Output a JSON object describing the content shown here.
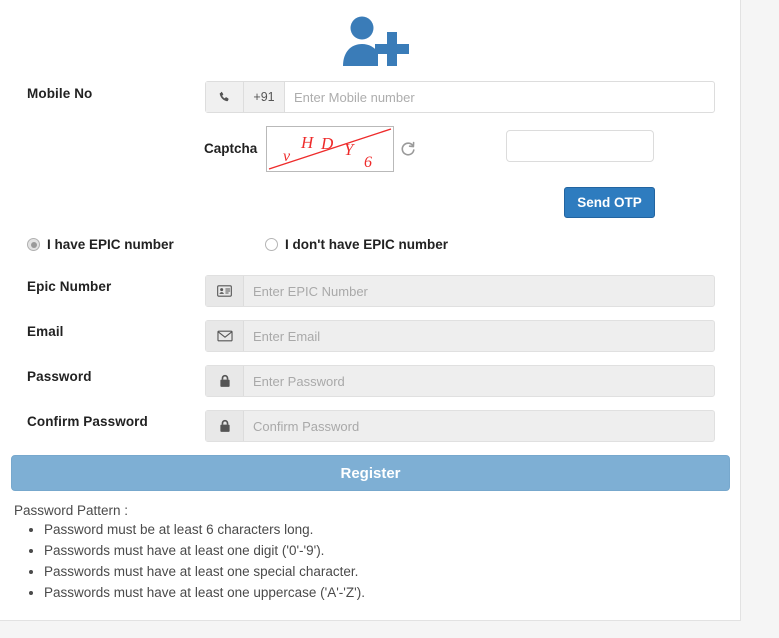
{
  "theme": {
    "page_background": "#f5f5f5",
    "card_background": "#ffffff",
    "logo_blue": "#3a7cb8",
    "send_otp_blue": "#2e7cbf",
    "register_blue": "#7eafd4",
    "captcha_red": "#ee2b2b",
    "label_color": "#222222",
    "placeholder_color": "#adadad"
  },
  "logo": {
    "icon": "add-user-icon"
  },
  "form": {
    "mobile": {
      "label": "Mobile No",
      "icon": "phone-icon",
      "country_code": "+91",
      "placeholder": "Enter Mobile number",
      "value": ""
    },
    "captcha": {
      "label": "Captcha",
      "characters": "vHDY6",
      "glyphs": [
        "v",
        "H",
        "D",
        "Y",
        "6"
      ],
      "refresh_icon": "refresh-icon",
      "answer_placeholder": "",
      "answer_value": ""
    },
    "send_otp": {
      "label": "Send OTP"
    },
    "epic_choice": {
      "options": [
        {
          "label": "I have EPIC number",
          "selected": true
        },
        {
          "label": "I don't have EPIC number",
          "selected": false
        }
      ]
    },
    "epic_number": {
      "label": "Epic Number",
      "icon": "id-card-icon",
      "placeholder": "Enter EPIC Number",
      "value": ""
    },
    "email": {
      "label": "Email",
      "icon": "envelope-icon",
      "placeholder": "Enter Email",
      "value": ""
    },
    "password": {
      "label": "Password",
      "icon": "lock-icon",
      "placeholder": "Enter Password",
      "value": ""
    },
    "confirm_password": {
      "label": "Confirm Password",
      "icon": "lock-icon",
      "placeholder": "Confirm Password",
      "value": ""
    },
    "register": {
      "label": "Register"
    }
  },
  "password_pattern": {
    "title": "Password Pattern :",
    "rules": [
      "Password must be at least 6 characters long.",
      "Passwords must have at least one digit ('0'-'9').",
      "Passwords must have at least one special character.",
      "Passwords must have at least one uppercase ('A'-'Z')."
    ]
  }
}
